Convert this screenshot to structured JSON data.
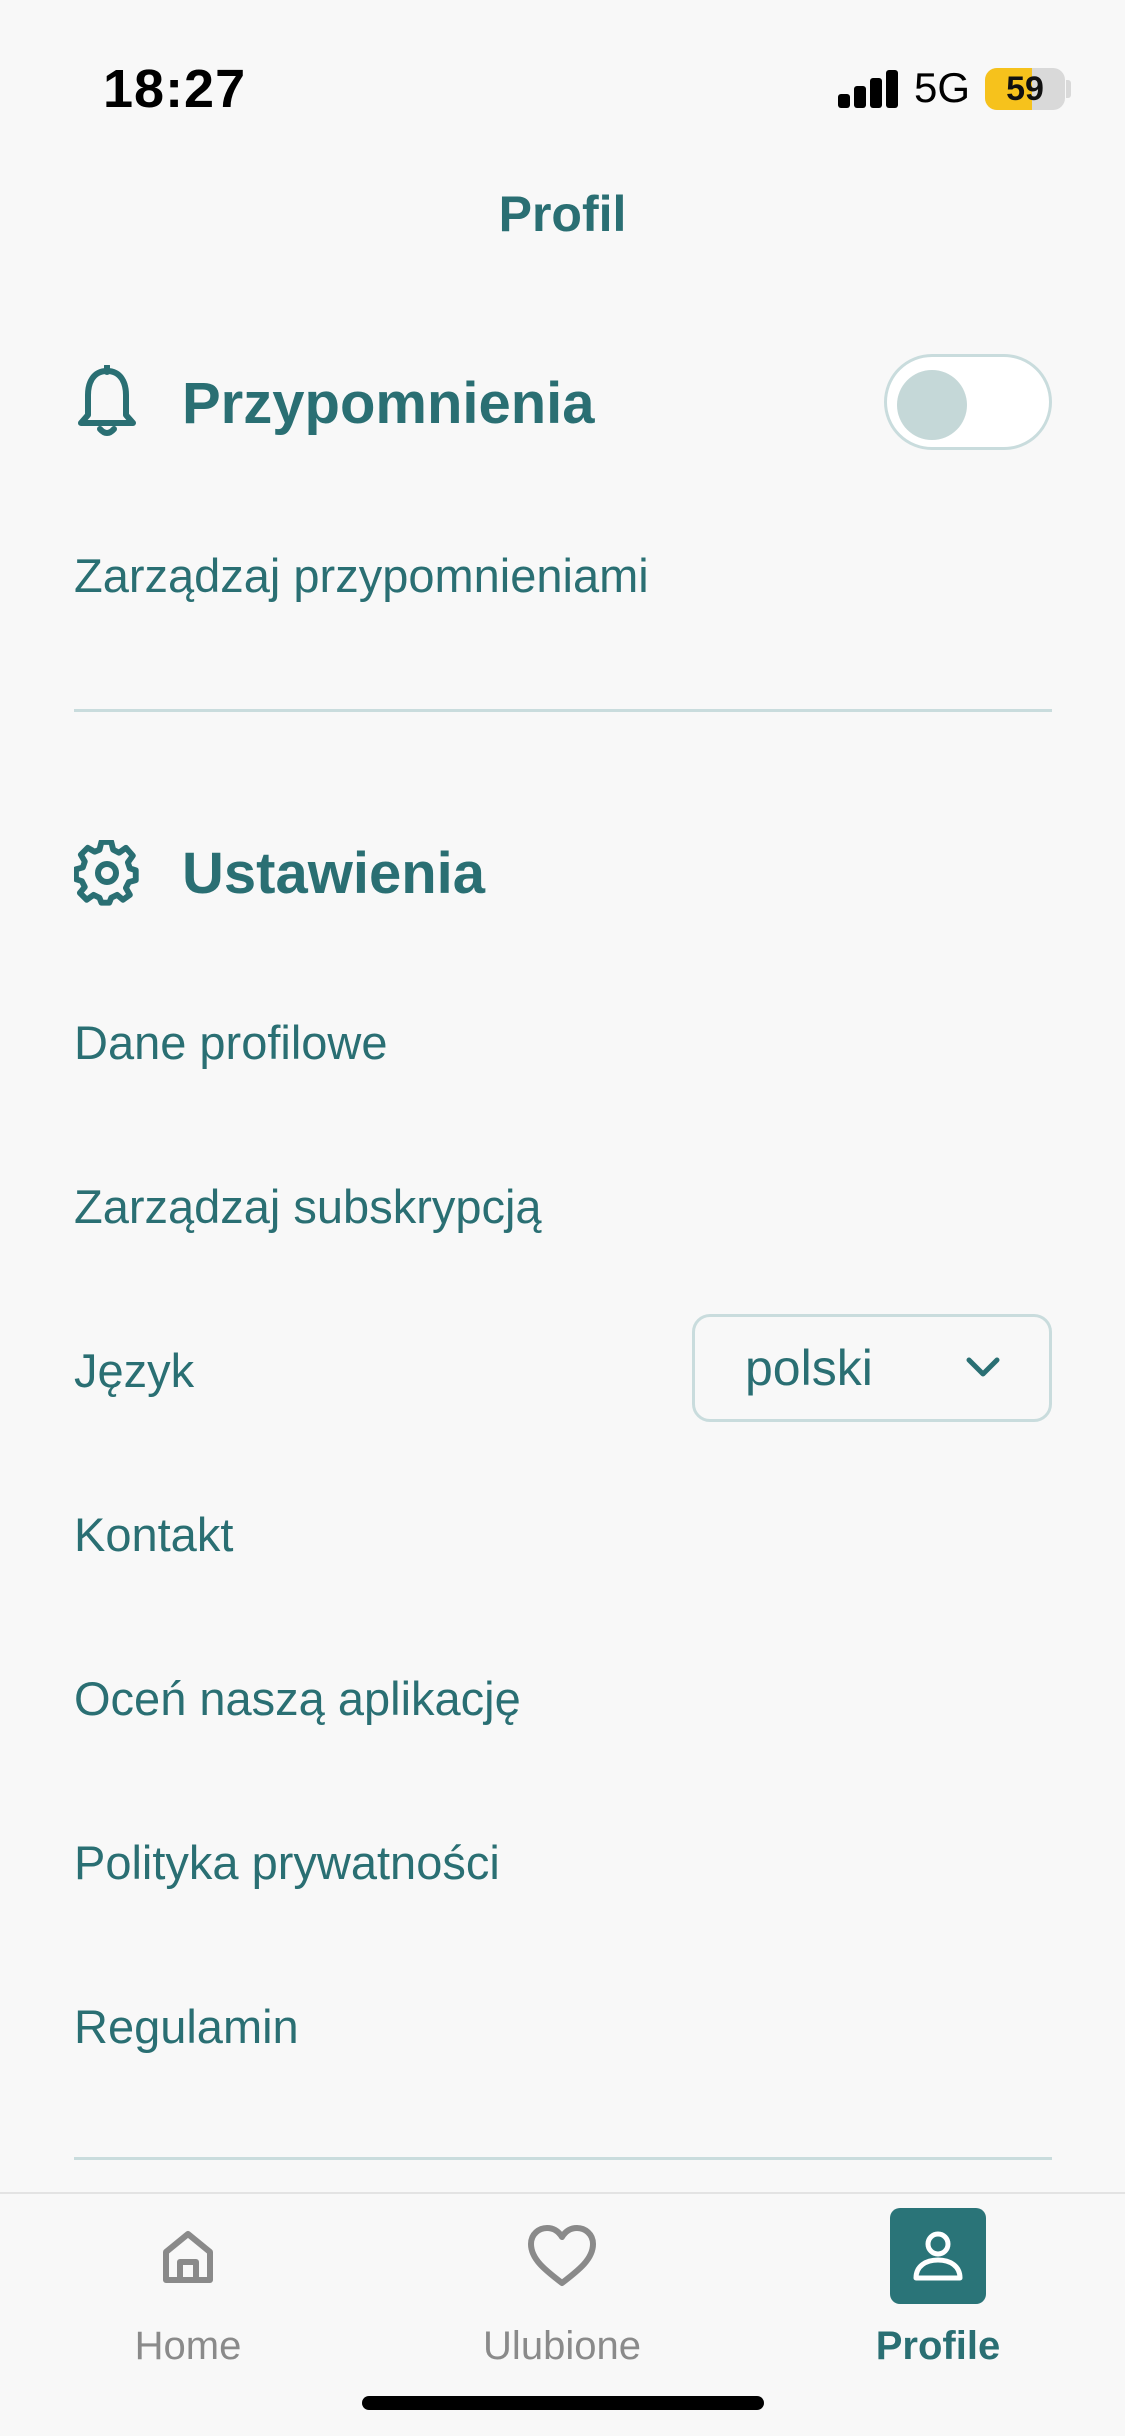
{
  "status_bar": {
    "time": "18:27",
    "network": "5G",
    "battery_percent": "59",
    "battery_level": 0.59,
    "battery_color": "#f6c21c"
  },
  "header": {
    "title": "Profil"
  },
  "reminders": {
    "title": "Przypomnienia",
    "icon": "bell-icon",
    "toggle_on": false,
    "manage_label": "Zarządzaj przypomnieniami"
  },
  "settings": {
    "title": "Ustawienia",
    "icon": "gear-icon",
    "items": [
      {
        "label": "Dane profilowe"
      },
      {
        "label": "Zarządzaj subskrypcją"
      },
      {
        "label": "Język"
      },
      {
        "label": "Kontakt"
      },
      {
        "label": "Oceń naszą aplikację"
      },
      {
        "label": "Polityka prywatności"
      },
      {
        "label": "Regulamin"
      }
    ],
    "language_value": "polski"
  },
  "tabbar": {
    "tabs": [
      {
        "label": "Home",
        "icon": "home-icon",
        "active": false
      },
      {
        "label": "Ulubione",
        "icon": "heart-icon",
        "active": false
      },
      {
        "label": "Profile",
        "icon": "person-icon",
        "active": true
      }
    ]
  },
  "colors": {
    "accent": "#2a6f73",
    "active_tab_bg": "#2a7478",
    "divider": "#c9dcdd",
    "background": "#f8f8f8"
  }
}
